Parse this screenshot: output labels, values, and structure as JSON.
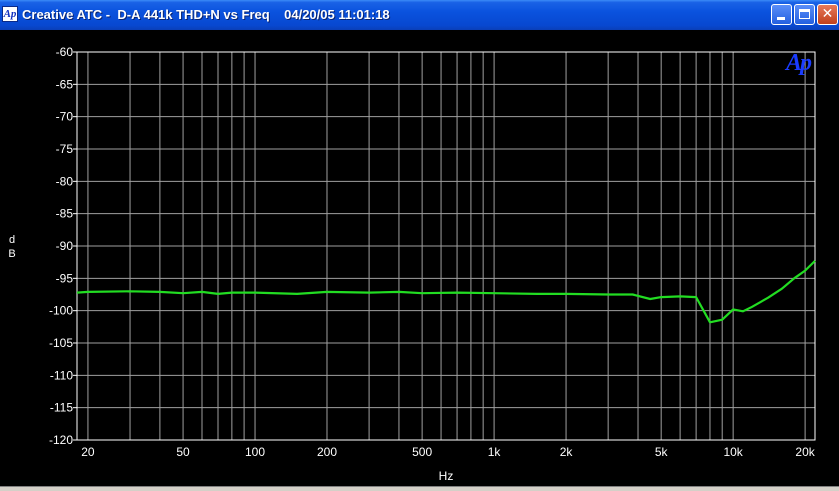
{
  "window": {
    "title": "Creative ATC -  D-A 441k THD+N vs Freq    04/20/05 11:01:18",
    "app_icon_text": "Ap",
    "close_glyph": "✕"
  },
  "logo": {
    "text": "Ap",
    "color": "#1a3cff"
  },
  "colors": {
    "plot_background": "#000000",
    "plot_border": "#ffffff",
    "grid": "#a0a0a0",
    "trace": "#22dd22",
    "axis_text": "#ffffff"
  },
  "chart_data": {
    "type": "line",
    "title": "",
    "xlabel": "Hz",
    "ylabel": "d B",
    "xscale": "log",
    "xlim": [
      18,
      22000
    ],
    "ylim": [
      -120,
      -60
    ],
    "grid": true,
    "x_tick_labels": [
      "20",
      "50",
      "100",
      "200",
      "500",
      "1k",
      "2k",
      "5k",
      "10k",
      "20k"
    ],
    "x_tick_values": [
      20,
      50,
      100,
      200,
      500,
      1000,
      2000,
      5000,
      10000,
      20000
    ],
    "y_tick_labels": [
      "-60",
      "-65",
      "-70",
      "-75",
      "-80",
      "-85",
      "-90",
      "-95",
      "-100",
      "-105",
      "-110",
      "-115",
      "-120"
    ],
    "y_tick_values": [
      -60,
      -65,
      -70,
      -75,
      -80,
      -85,
      -90,
      -95,
      -100,
      -105,
      -110,
      -115,
      -120
    ],
    "series": [
      {
        "color": "#22dd22",
        "x": [
          18,
          20,
          30,
          40,
          50,
          60,
          70,
          80,
          100,
          150,
          200,
          300,
          400,
          500,
          700,
          1000,
          1500,
          2000,
          3000,
          3800,
          4500,
          5000,
          6000,
          7000,
          8000,
          9000,
          10000,
          11000,
          12000,
          14000,
          16000,
          18000,
          20000,
          22000
        ],
        "y": [
          -97.2,
          -97.1,
          -97.0,
          -97.1,
          -97.3,
          -97.1,
          -97.4,
          -97.2,
          -97.2,
          -97.4,
          -97.1,
          -97.2,
          -97.1,
          -97.3,
          -97.2,
          -97.3,
          -97.4,
          -97.4,
          -97.5,
          -97.5,
          -98.2,
          -97.9,
          -97.8,
          -97.9,
          -101.8,
          -101.4,
          -99.8,
          -100.1,
          -99.4,
          -98.0,
          -96.6,
          -95.0,
          -93.8,
          -92.3
        ]
      }
    ]
  }
}
